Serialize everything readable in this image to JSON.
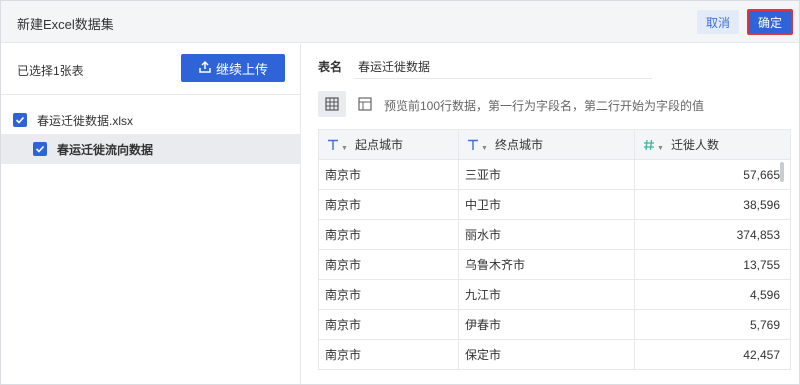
{
  "dialog": {
    "title": "新建Excel数据集",
    "cancel_label": "取消",
    "ok_label": "确定"
  },
  "left": {
    "selected_count": "已选择1张表",
    "upload_label": "继续上传",
    "tree": {
      "file_name": "春运迁徙数据.xlsx",
      "sheet_name": "春运迁徙流向数据"
    }
  },
  "right": {
    "table_name_label": "表名",
    "table_name_value": "春运迁徙数据",
    "preview_hint": "预览前100行数据，第一行为字段名，第二行开始为字段的值",
    "columns": [
      {
        "label": "起点城市",
        "type_icon": "T"
      },
      {
        "label": "终点城市",
        "type_icon": "T"
      },
      {
        "label": "迁徙人数",
        "type_icon": "#"
      }
    ],
    "rows": [
      [
        "南京市",
        "三亚市",
        "57,665"
      ],
      [
        "南京市",
        "中卫市",
        "38,596"
      ],
      [
        "南京市",
        "丽水市",
        "374,853"
      ],
      [
        "南京市",
        "乌鲁木齐市",
        "13,755"
      ],
      [
        "南京市",
        "九江市",
        "4,596"
      ],
      [
        "南京市",
        "伊春市",
        "5,769"
      ],
      [
        "南京市",
        "保定市",
        "42,457"
      ]
    ]
  },
  "colors": {
    "primary": "#2f64d8",
    "cancel_bg": "#e3ebf8",
    "highlight_border": "#e0343c",
    "text_type_icon": "#3d6fd6",
    "number_type_icon": "#3fb59a"
  }
}
